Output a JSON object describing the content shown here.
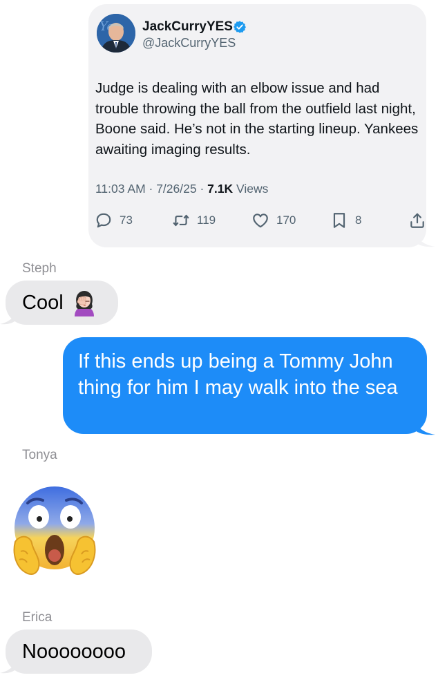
{
  "tweet": {
    "author_name": "JackCurryYES",
    "author_handle": "@JackCurryYES",
    "text": "Judge is dealing with an elbow issue and had trouble throwing the ball from the outfield last night, Boone said. He’s not in the starting lineup. Yankees awaiting imaging results.",
    "time": "11:03 AM",
    "separator": " · ",
    "date": "7/26/25",
    "views_count": "7.1K",
    "views_label": "Views",
    "actions": {
      "replies": "73",
      "reposts": "119",
      "likes": "170",
      "bookmarks": "8"
    },
    "icons": [
      "reply-icon",
      "repost-icon",
      "like-icon",
      "bookmark-icon",
      "share-icon",
      "verified-badge-icon"
    ]
  },
  "messages": [
    {
      "sender": "Steph",
      "text": "Cool",
      "emoji": "woman-facepalming"
    },
    {
      "sender": "",
      "text": "If this ends up being a Tommy John thing for him I may walk into the sea",
      "outgoing": true
    },
    {
      "sender": "Tonya",
      "text": "",
      "emoji": "face-screaming-in-fear"
    },
    {
      "sender": "Erica",
      "text": "Noooooooo"
    }
  ],
  "colors": {
    "sent_bubble": "#1d8cf8",
    "received_bubble": "#e9e9eb",
    "tweet_bubble": "#f2f2f4",
    "verified_blue": "#1d9bf0",
    "muted_text": "#8e8e93"
  }
}
